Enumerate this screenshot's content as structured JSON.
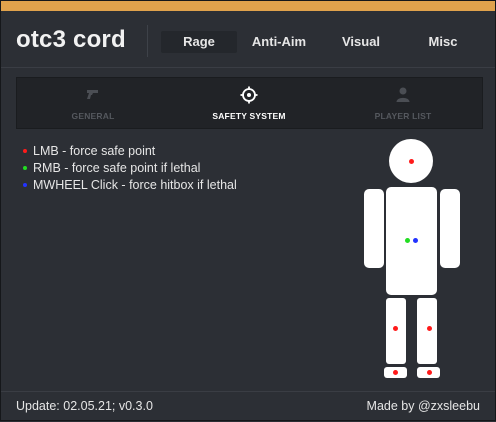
{
  "colors": {
    "accent_bar": "#e0a24c",
    "background": "#2c2f35",
    "panel": "#212327",
    "dot_red": "#ff1a1a",
    "dot_green": "#22dd22",
    "dot_blue": "#2233ff",
    "body_figure": "#ffffff"
  },
  "app": {
    "title": "otc3 cord"
  },
  "tabs": [
    {
      "label": "Rage",
      "active": true
    },
    {
      "label": "Anti-Aim",
      "active": false
    },
    {
      "label": "Visual",
      "active": false
    },
    {
      "label": "Misc",
      "active": false
    }
  ],
  "subtabs": [
    {
      "label": "GENERAL",
      "icon": "pistol-icon",
      "active": false
    },
    {
      "label": "SAFETY SYSTEM",
      "icon": "crosshair-icon",
      "active": true
    },
    {
      "label": "PLAYER LIST",
      "icon": "user-icon",
      "active": false
    }
  ],
  "legend": [
    {
      "color": "red",
      "text": "LMB - force safe point"
    },
    {
      "color": "green",
      "text": "RMB - force safe point if lethal"
    },
    {
      "color": "blue",
      "text": "MWHEEL Click - force hitbox if lethal"
    }
  ],
  "hitbox_points": [
    {
      "name": "head",
      "color": "red"
    },
    {
      "name": "chest",
      "color": "green"
    },
    {
      "name": "stomach",
      "color": "blue"
    },
    {
      "name": "left-knee",
      "color": "red"
    },
    {
      "name": "right-knee",
      "color": "red"
    },
    {
      "name": "left-foot",
      "color": "red"
    },
    {
      "name": "right-foot",
      "color": "red"
    }
  ],
  "footer": {
    "update": "Update: 02.05.21; v0.3.0",
    "author": "Made by @zxsleebu"
  }
}
